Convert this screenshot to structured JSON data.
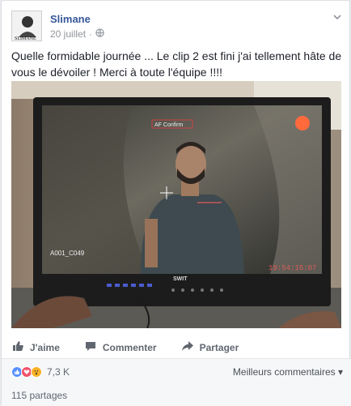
{
  "post": {
    "author": "Slimane",
    "avatar_text": "SLIMANE",
    "date": "20 juillet",
    "separator": "·",
    "text": "Quelle formidable journée ... Le clip 2 est fini j'ai tellement hâte de vous le dévoiler ! Merci à toute l'équipe !!!!"
  },
  "photo": {
    "monitor_brand": "SWIT",
    "focus_label": "AF Confirm",
    "clip_name": "A001_C049",
    "timecode": "19:54:15:07"
  },
  "actions": {
    "like": "J'aime",
    "comment": "Commenter",
    "share": "Partager"
  },
  "reactions": {
    "count": "7,3 K",
    "sort_label": "Meilleurs commentaires",
    "sort_arrow": "▾",
    "shares": "115 partages"
  },
  "colors": {
    "link": "#365899",
    "like_blue": "#5890ff",
    "love_red": "#f25268",
    "wow_yellow": "#f7b125"
  },
  "icons": [
    "globe-icon",
    "chevron-down-icon",
    "like-icon",
    "comment-icon",
    "share-icon"
  ]
}
